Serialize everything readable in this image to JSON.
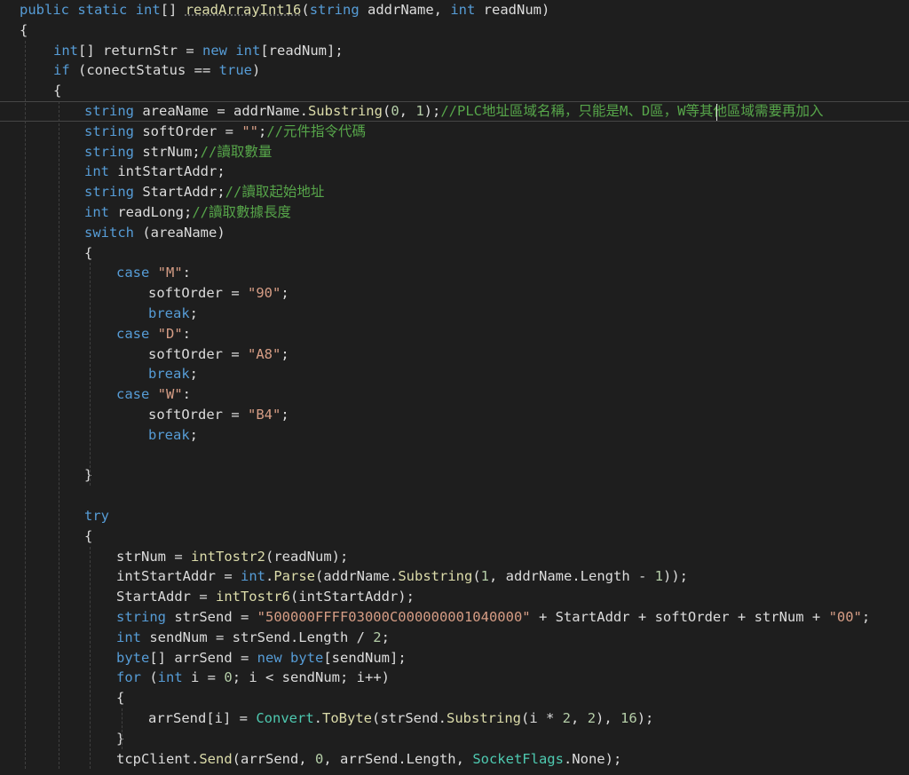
{
  "code_lines": [
    "public static int[] readArrayInt16(string addrName, int readNum)",
    "{",
    "int[] returnStr = new int[readNum];",
    "if (conectStatus == true)",
    "{",
    "string areaName = addrName.Substring(0, 1);//PLC地址區域名稱，只能是M、D區，W等其他區域需要再加入",
    "string softOrder = \"\";//元件指令代碼",
    "string strNum;//讀取數量",
    "int intStartAddr;",
    "string StartAddr;//讀取起始地址",
    "int readLong;//讀取數據長度",
    "switch (areaName)",
    "{",
    "case \"M\":",
    "softOrder = \"90\";",
    "break;",
    "case \"D\":",
    "softOrder = \"A8\";",
    "break;",
    "case \"W\":",
    "softOrder = \"B4\";",
    "break;",
    "",
    "}",
    "",
    "try",
    "{",
    "strNum = intTostr2(readNum);",
    "intStartAddr = int.Parse(addrName.Substring(1, addrName.Length - 1));",
    "StartAddr = intTostr6(intStartAddr);",
    "string strSend = \"500000FFFF03000C000000001040000\" + StartAddr + softOrder + strNum + \"00\";",
    "int sendNum = strSend.Length / 2;",
    "byte[] arrSend = new byte[sendNum];",
    "for (int i = 0; i < sendNum; i++)",
    "{",
    "arrSend[i] = Convert.ToByte(strSend.Substring(i * 2, 2), 16);",
    "}",
    "tcpClient.Send(arrSend, 0, arrSend.Length, SocketFlags.None);"
  ],
  "colors": {
    "background": "#1e1e1e",
    "keyword": "#569cd6",
    "type": "#4ec9b0",
    "string": "#d69d85",
    "comment": "#57a64a",
    "number": "#b5cea8",
    "default": "#dcdcdc"
  }
}
